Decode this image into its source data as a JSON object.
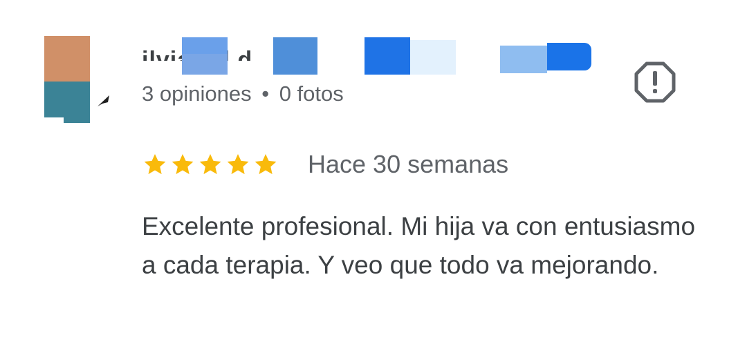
{
  "review": {
    "author": {
      "name": "ilvia C  l  d",
      "avatar_colors": [
        "#d09068",
        "#3b8396"
      ],
      "redaction_colors": [
        "#7aa6e6",
        "#4f8fd9",
        "#1f73e6",
        "#e3f1fd",
        "#8fbdf0",
        "#1a73e8"
      ]
    },
    "meta": {
      "reviews": "3 opiniones",
      "separator": "•",
      "photos": "0 fotos"
    },
    "report_icon": "report-flag-icon",
    "rating": {
      "value": 5,
      "max": 5,
      "star_color": "#f9ba0b"
    },
    "date": "Hace 30 semanas",
    "text": "Excelente profesional. Mi hija va con entusiasmo a cada terapia. Y veo que todo va mejorando."
  }
}
